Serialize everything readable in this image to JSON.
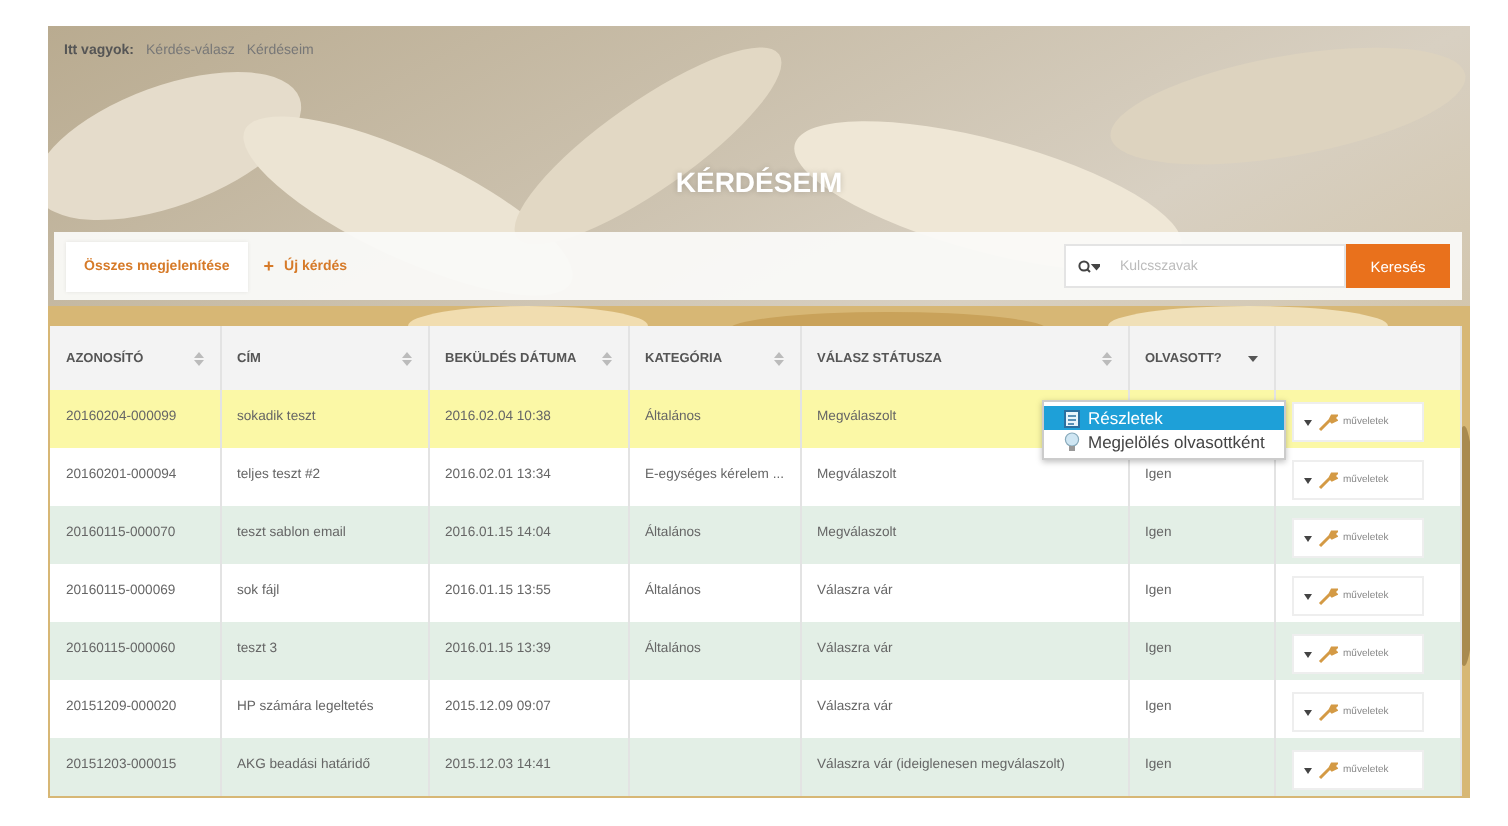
{
  "breadcrumb": {
    "label": "Itt vagyok:",
    "items": [
      "Kérdés-válasz",
      "Kérdéseim"
    ]
  },
  "title": "KÉRDÉSEIM",
  "toolbar": {
    "show_all": "Összes megjelenítése",
    "new_question": {
      "icon": "+",
      "label": "Új kérdés"
    },
    "search": {
      "placeholder": "Kulcsszavak"
    },
    "search_button": "Keresés"
  },
  "table": {
    "columns": [
      {
        "label": "AZONOSÍTÓ",
        "kind": "sortable"
      },
      {
        "label": "CÍM",
        "kind": "sortable"
      },
      {
        "label": "BEKÜLDÉS DÁTUMA",
        "kind": "sortable"
      },
      {
        "label": "KATEGÓRIA",
        "kind": "sortable"
      },
      {
        "label": "VÁLASZ STÁTUSZA",
        "kind": "sortable"
      },
      {
        "label": "OLVASOTT?",
        "kind": "sorted_desc"
      },
      {
        "kind": "plain"
      }
    ],
    "rows": [
      {
        "id": "20160204-000099",
        "title": "sokadik teszt",
        "date": "2016.02.04 10:38",
        "category": "Általános",
        "status": "Megválaszolt",
        "action": "műveletek",
        "selected": true
      },
      {
        "id": "20160201-000094",
        "title": "teljes teszt #2",
        "date": "2016.02.01 13:34",
        "category": "E-egységes kérelem ...",
        "status": "Megválaszolt",
        "read": "Igen",
        "action": "műveletek",
        "selected": false
      },
      {
        "id": "20160115-000070",
        "title": "teszt sablon email",
        "date": "2016.01.15 14:04",
        "category": "Általános",
        "status": "Megválaszolt",
        "read": "Igen",
        "action": "műveletek",
        "selected": false
      },
      {
        "id": "20160115-000069",
        "title": "sok fájl",
        "date": "2016.01.15 13:55",
        "category": "Általános",
        "status": "Válaszra vár",
        "read": "Igen",
        "action": "műveletek",
        "selected": false
      },
      {
        "id": "20160115-000060",
        "title": "teszt 3",
        "date": "2016.01.15 13:39",
        "category": "Általános",
        "status": "Válaszra vár",
        "read": "Igen",
        "action": "műveletek",
        "selected": false
      },
      {
        "id": "20151209-000020",
        "title": "HP számára legeltetés",
        "date": "2015.12.09 09:07",
        "category": "",
        "status": "Válaszra vár",
        "read": "Igen",
        "action": "műveletek",
        "selected": false
      },
      {
        "id": "20151203-000015",
        "title": "AKG beadási határidő",
        "date": "2015.12.03 14:41",
        "category": "",
        "status": "Válaszra vár (ideiglenesen megválaszolt)",
        "read": "Igen",
        "action": "műveletek",
        "selected": false
      }
    ]
  },
  "context_menu": {
    "items": [
      {
        "label": "Részletek",
        "kind": "details",
        "selected": true
      },
      {
        "label": "Megjelölés olvasottként",
        "kind": "mark_read",
        "selected": false
      }
    ]
  }
}
